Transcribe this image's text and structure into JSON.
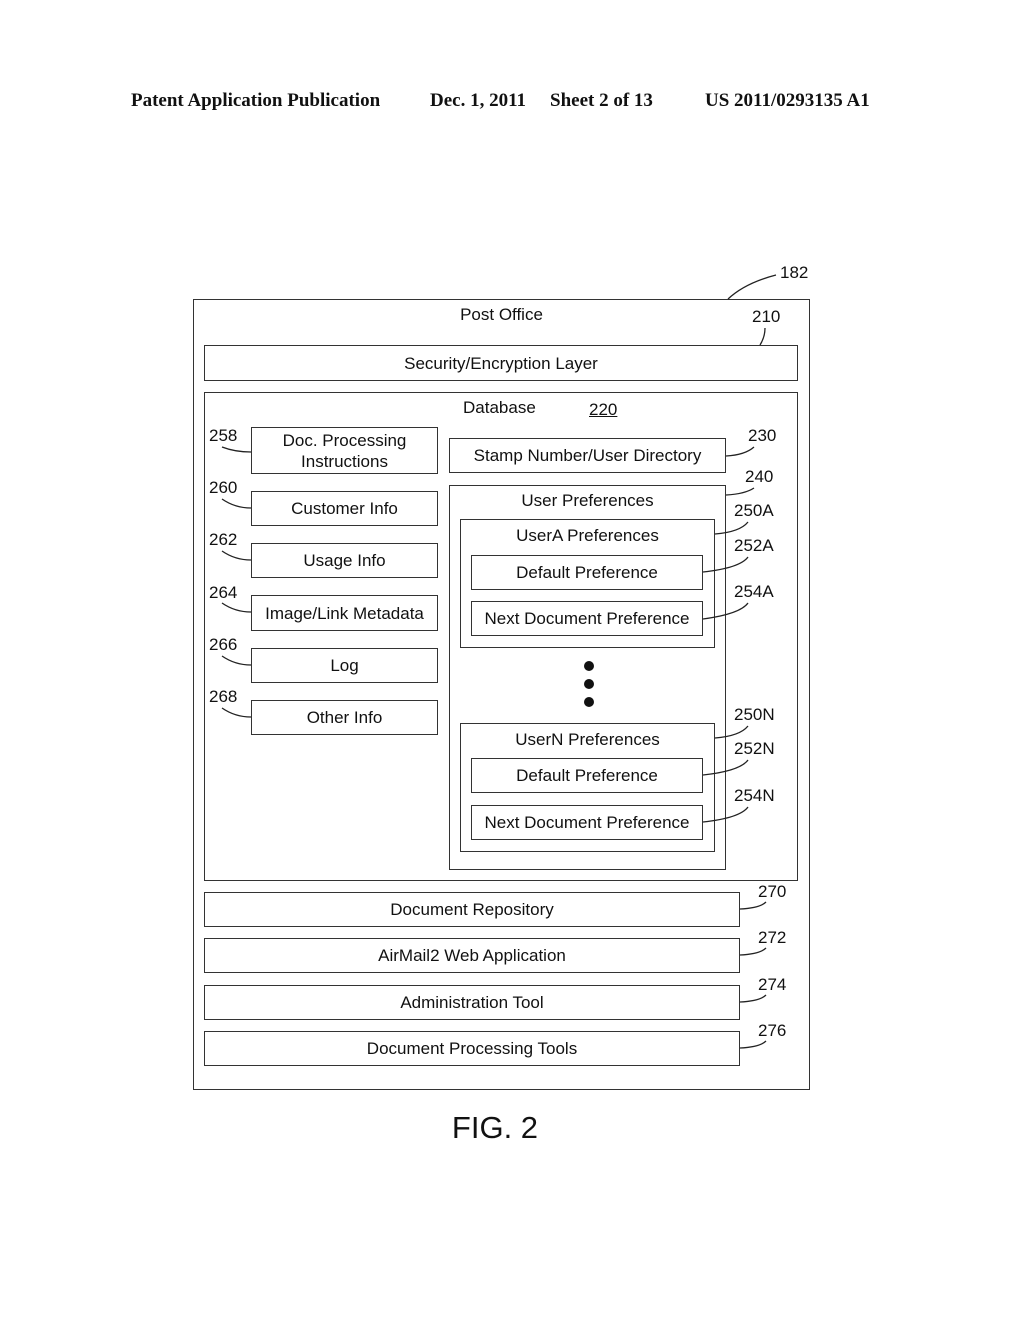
{
  "header": {
    "publication": "Patent Application Publication",
    "date": "Dec. 1, 2011",
    "sheet": "Sheet 2 of 13",
    "number": "US 2011/0293135 A1"
  },
  "diagram": {
    "outer": {
      "ref": "182",
      "title": "Post Office"
    },
    "security": {
      "ref": "210",
      "label": "Security/Encryption Layer"
    },
    "database": {
      "title": "Database",
      "ref": "220",
      "left_items": [
        {
          "ref": "258",
          "label": "Doc. Processing Instructions"
        },
        {
          "ref": "260",
          "label": "Customer Info"
        },
        {
          "ref": "262",
          "label": "Usage Info"
        },
        {
          "ref": "264",
          "label": "Image/Link Metadata"
        },
        {
          "ref": "266",
          "label": "Log"
        },
        {
          "ref": "268",
          "label": "Other Info"
        }
      ],
      "directory": {
        "ref": "230",
        "label": "Stamp Number/User Directory"
      },
      "user_preferences": {
        "ref": "240",
        "title": "User Preferences",
        "users": [
          {
            "ref": "250A",
            "title": "UserA Preferences",
            "default": {
              "ref": "252A",
              "label": "Default Preference"
            },
            "next": {
              "ref": "254A",
              "label": "Next Document Preference"
            }
          },
          {
            "ref": "250N",
            "title": "UserN Preferences",
            "default": {
              "ref": "252N",
              "label": "Default Preference"
            },
            "next": {
              "ref": "254N",
              "label": "Next Document Preference"
            }
          }
        ]
      }
    },
    "bottom_items": [
      {
        "ref": "270",
        "label": "Document Repository"
      },
      {
        "ref": "272",
        "label": "AirMail2 Web Application"
      },
      {
        "ref": "274",
        "label": "Administration Tool"
      },
      {
        "ref": "276",
        "label": "Document Processing Tools"
      }
    ]
  },
  "figure_label": "FIG. 2"
}
